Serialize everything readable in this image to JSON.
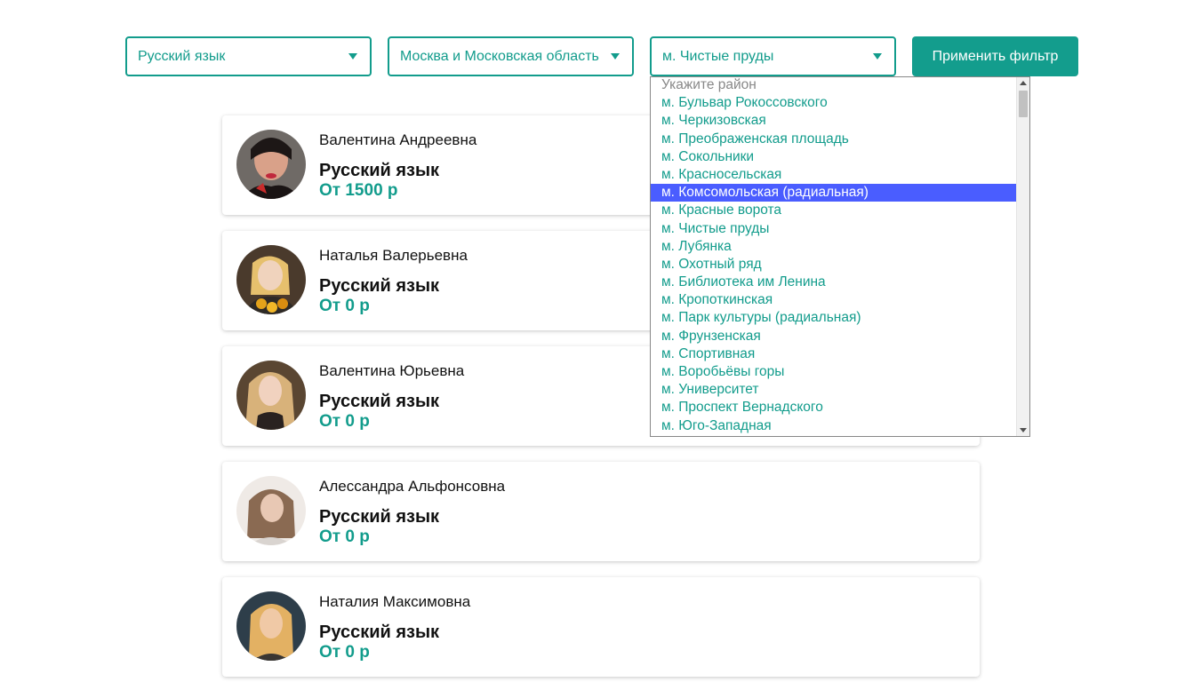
{
  "filters": {
    "subject": {
      "value": "Русский язык"
    },
    "region": {
      "value": "Москва и Московская область"
    },
    "district": {
      "value": "м. Чистые пруды"
    },
    "apply_label": "Применить фильтр"
  },
  "district_dropdown": {
    "placeholder": "Укажите район",
    "options": [
      "м. Бульвар Рокоссовского",
      "м. Черкизовская",
      "м. Преображенская площадь",
      "м. Сокольники",
      "м. Красносельская",
      "м. Комсомольская (радиальная)",
      "м. Красные ворота",
      "м. Чистые пруды",
      "м. Лубянка",
      "м. Охотный ряд",
      "м. Библиотека им Ленина",
      "м. Кропоткинская",
      "м. Парк культуры (радиальная)",
      "м. Фрунзенская",
      "м. Спортивная",
      "м. Воробьёвы горы",
      "м. Университет",
      "м. Проспект Вернадского",
      "м. Юго-Западная"
    ],
    "highlighted": "м. Комсомольская (радиальная)"
  },
  "tutors": [
    {
      "name": "Валентина Андреевна",
      "subject": "Русский язык",
      "price": "От 1500 р"
    },
    {
      "name": "Наталья Валерьевна",
      "subject": "Русский язык",
      "price": "От 0 р"
    },
    {
      "name": "Валентина Юрьевна",
      "subject": "Русский язык",
      "price": "От 0 р"
    },
    {
      "name": "Алессандра Альфонсовна",
      "subject": "Русский язык",
      "price": "От 0 р"
    },
    {
      "name": "Наталия Максимовна",
      "subject": "Русский язык",
      "price": "От 0 р"
    }
  ],
  "colors": {
    "accent": "#129c8c",
    "highlight": "#4a5dff"
  }
}
